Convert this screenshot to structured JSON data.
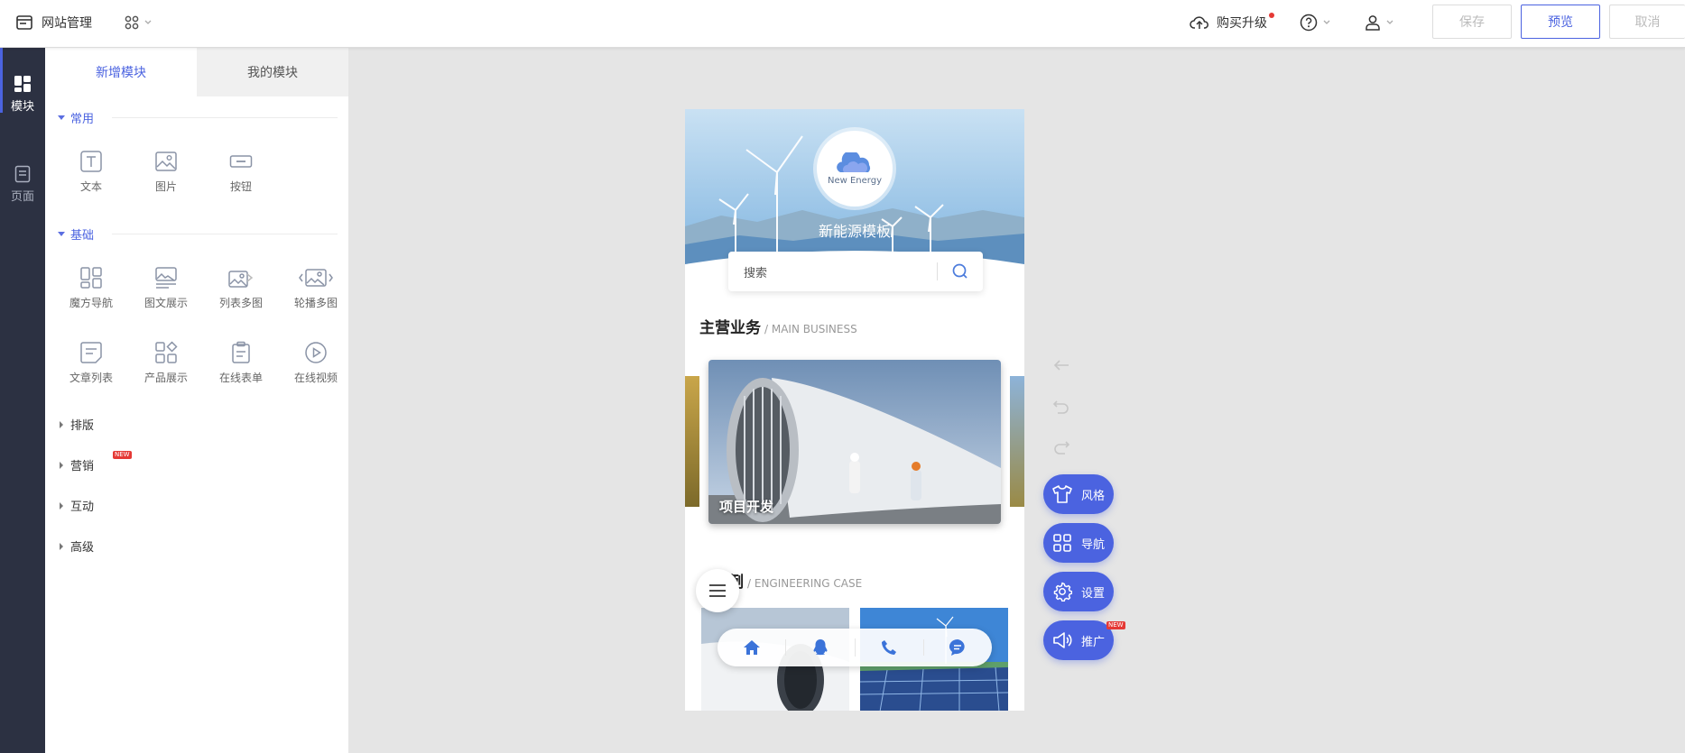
{
  "topbar": {
    "title": "网站管理",
    "buy_upgrade": "购买升级",
    "save": "保存",
    "preview": "预览",
    "cancel": "取消"
  },
  "leftnav": {
    "items": [
      {
        "label": "模块",
        "icon": "module-icon",
        "active": true
      },
      {
        "label": "页面",
        "icon": "page-icon",
        "active": false
      }
    ]
  },
  "panel": {
    "tabs": [
      {
        "label": "新增模块",
        "active": true
      },
      {
        "label": "我的模块",
        "active": false
      }
    ],
    "sections": {
      "common": {
        "label": "常用",
        "items": [
          {
            "label": "文本",
            "icon": "text-icon"
          },
          {
            "label": "图片",
            "icon": "image-icon"
          },
          {
            "label": "按钮",
            "icon": "button-icon"
          }
        ]
      },
      "basic": {
        "label": "基础",
        "items": [
          {
            "label": "魔方导航",
            "icon": "cube-nav-icon"
          },
          {
            "label": "图文展示",
            "icon": "image-text-icon"
          },
          {
            "label": "列表多图",
            "icon": "list-images-icon"
          },
          {
            "label": "轮播多图",
            "icon": "carousel-icon"
          },
          {
            "label": "文章列表",
            "icon": "article-list-icon"
          },
          {
            "label": "产品展示",
            "icon": "product-icon"
          },
          {
            "label": "在线表单",
            "icon": "form-icon"
          },
          {
            "label": "在线视频",
            "icon": "video-icon"
          }
        ]
      },
      "collapsed": [
        {
          "label": "排版"
        },
        {
          "label": "营销",
          "badge": "NEW"
        },
        {
          "label": "互动"
        },
        {
          "label": "高级"
        }
      ]
    }
  },
  "preview": {
    "logo_text": "New Energy",
    "site_title": "新能源模板",
    "search_placeholder": "搜索",
    "section1_title": "主营业务",
    "section1_sub": "/ MAIN BUSINESS",
    "slide_caption": "项目开发",
    "section2_title": "例",
    "section2_sub": "/ ENGINEERING CASE"
  },
  "fabs": [
    {
      "label": "风格",
      "icon": "shirt-icon"
    },
    {
      "label": "导航",
      "icon": "grid-icon"
    },
    {
      "label": "设置",
      "icon": "gear-icon"
    },
    {
      "label": "推广",
      "icon": "megaphone-icon",
      "badge": "NEW"
    }
  ],
  "colors": {
    "accent": "#4b63e0",
    "sidebar": "#2c3142"
  }
}
